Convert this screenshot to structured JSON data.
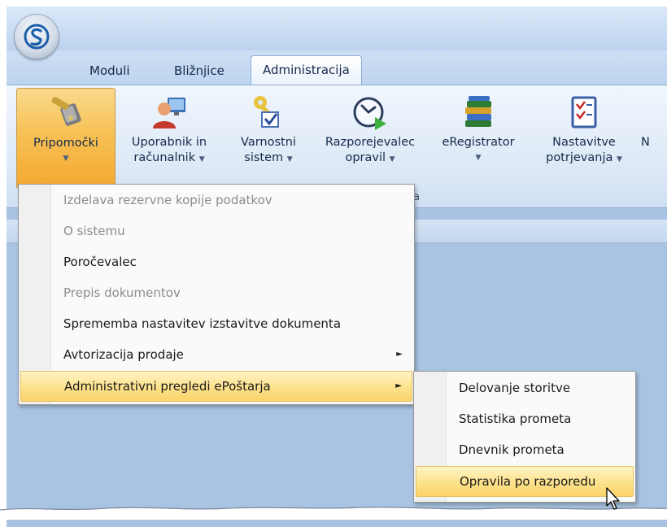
{
  "tabs": [
    {
      "label": "Moduli"
    },
    {
      "label": "Bližnjice"
    },
    {
      "label": "Administracija"
    }
  ],
  "ribbon": {
    "buttons": [
      {
        "line1": "Pripomočki",
        "line2": ""
      },
      {
        "line1": "Uporabnik in",
        "line2": "računalnik"
      },
      {
        "line1": "Varnostni",
        "line2": "sistem"
      },
      {
        "line1": "Razporejevalec",
        "line2": "opravil"
      },
      {
        "line1": "eRegistrator",
        "line2": ""
      },
      {
        "line1": "Nastavitve",
        "line2": "potrjevanja"
      },
      {
        "line1": "N",
        "line2": ""
      }
    ],
    "dropdown_glyph": "▼",
    "group_label_tail": "ja"
  },
  "menu": {
    "items": [
      {
        "label": "Izdelava rezervne kopije podatkov"
      },
      {
        "label": "O sistemu"
      },
      {
        "label": "Poročevalec"
      },
      {
        "label": "Prepis dokumentov"
      },
      {
        "label": "Sprememba nastavitev izstavitve dokumenta"
      },
      {
        "label": "Avtorizacija prodaje"
      },
      {
        "label": "Administrativni pregledi ePoštarja"
      }
    ],
    "submenu_glyph": "►"
  },
  "submenu": {
    "items": [
      {
        "label": "Delovanje storitve"
      },
      {
        "label": "Statistika prometa"
      },
      {
        "label": "Dnevnik prometa"
      },
      {
        "label": "Opravila po razporedu"
      }
    ]
  },
  "colors": {
    "accent_highlight": "#fbd36a",
    "pressed": "#f4a830",
    "workspace": "#a9c3e2"
  }
}
